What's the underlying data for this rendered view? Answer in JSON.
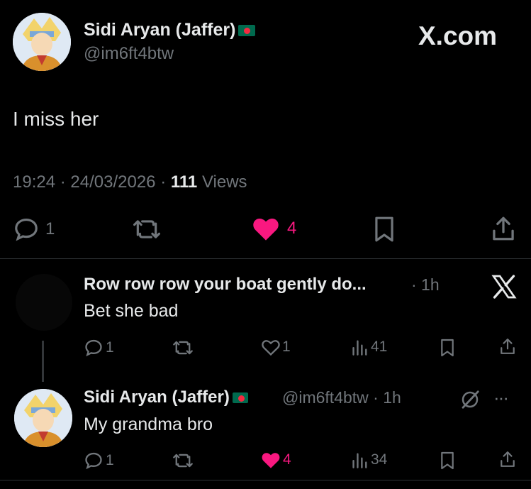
{
  "brand": {
    "name": "X.com"
  },
  "post": {
    "author_name": "Sidi Aryan (Jaffer)",
    "handle": "@im6ft4btw",
    "text": "I miss her",
    "time": "19:24",
    "sep1": "·",
    "date": "24/03/2026",
    "sep2": "·",
    "views_count": "111",
    "views_label": "Views",
    "reply_count": "1",
    "like_count": "4"
  },
  "replies": [
    {
      "author_name": "Row row row your boat gently do...",
      "time": "· 1h",
      "text": "Bet she bad",
      "reply_count": "1",
      "like_count": "1",
      "views_count": "41"
    },
    {
      "author_name": "Sidi Aryan (Jaffer)",
      "handle_time": "@im6ft4btw · 1h",
      "more": "···",
      "text": "My grandma bro",
      "reply_count": "1",
      "like_count": "4",
      "views_count": "34"
    }
  ],
  "colors": {
    "like_active": "#f91880",
    "muted": "#71767b",
    "text": "#e7e9ea",
    "flag_green": "#006a4e",
    "flag_red": "#f42a41"
  }
}
